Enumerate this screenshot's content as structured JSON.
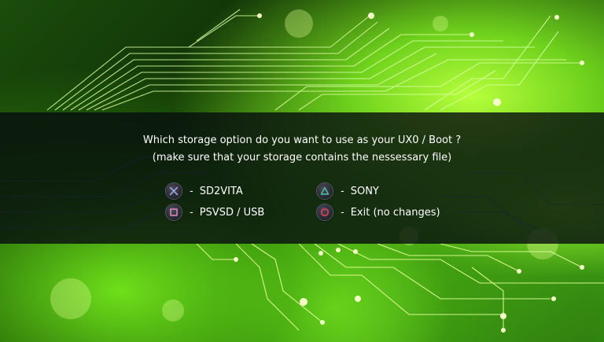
{
  "dialog": {
    "question_line1": "Which storage option do you want to use as your UX0 / Boot ?",
    "question_line2": "(make sure that your storage contains the nessessary file)"
  },
  "options": {
    "cross": {
      "icon": "cross-icon",
      "dash": "-",
      "label": "SD2VITA"
    },
    "square": {
      "icon": "square-icon",
      "dash": "-",
      "label": "PSVSD / USB"
    },
    "triangle": {
      "icon": "triangle-icon",
      "dash": "-",
      "label": "SONY"
    },
    "circle": {
      "icon": "circle-icon",
      "dash": "-",
      "label": "Exit (no changes)"
    }
  },
  "colors": {
    "band": "#060c0e",
    "cross": "#9aa7d8",
    "square": "#d88fb8",
    "triangle": "#49c6a0",
    "circle": "#e0455a",
    "circuit_glow": "#d8ff7a"
  }
}
